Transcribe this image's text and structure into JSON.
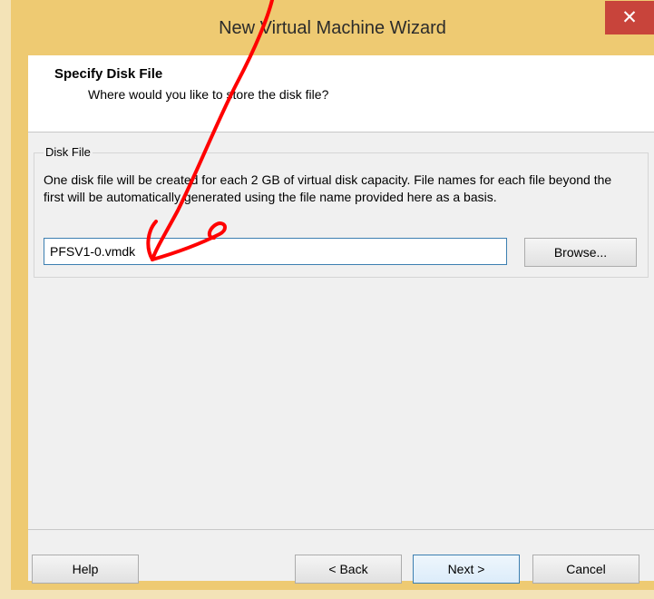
{
  "window": {
    "title": "New Virtual Machine Wizard",
    "close_glyph": "✕"
  },
  "header": {
    "title": "Specify Disk File",
    "subtitle": "Where would you like to store the disk file?"
  },
  "disk_file": {
    "legend": "Disk File",
    "description": "One disk file will be created for each 2 GB of virtual disk capacity. File names for each file beyond the first will be automatically generated using the file name provided here as a basis.",
    "filename_value": "PFSV1-0.vmdk",
    "browse_label": "Browse..."
  },
  "footer": {
    "help_label": "Help",
    "back_label": "< Back",
    "next_label": "Next >",
    "cancel_label": "Cancel"
  },
  "annotation": {
    "color": "#ff0000"
  }
}
